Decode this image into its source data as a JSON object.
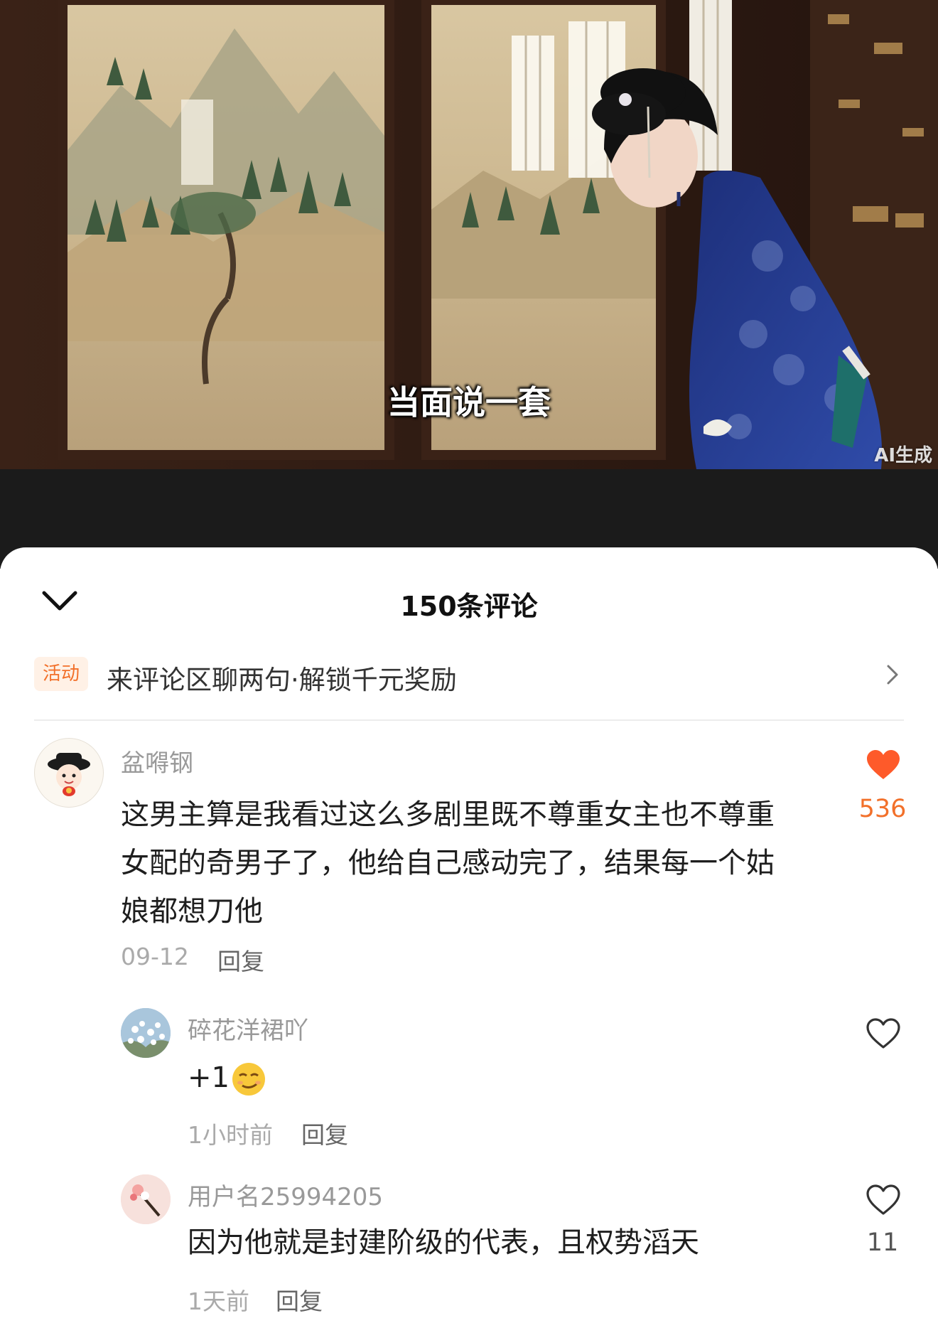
{
  "video": {
    "subtitle": "当面说一套",
    "ai_badge": "AI生成"
  },
  "comments_panel": {
    "title": "150条评论",
    "activity": {
      "tag": "活动",
      "text": "来评论区聊两句·解锁千元奖励"
    },
    "comments": [
      {
        "username": "盆嘚钢",
        "text_lines": [
          "这男主算是我看过这么多剧里既不尊重女主也不尊重",
          "女配的奇男子了，他给自己感动完了，结果每一个姑",
          "娘都想刀他"
        ],
        "time": "09-12",
        "reply_label": "回复",
        "likes": "536",
        "liked": true
      }
    ],
    "replies": [
      {
        "username": "碎花洋裙吖",
        "text": "+1",
        "emoji": "smirk-emoji",
        "time": "1小时前",
        "reply_label": "回复",
        "likes": "",
        "liked": false
      },
      {
        "username": "用户名25994205",
        "text": "因为他就是封建阶级的代表，且权势滔天",
        "time": "1天前",
        "reply_label": "回复",
        "likes": "11",
        "liked": false
      }
    ]
  },
  "colors": {
    "accent": "#f2702a",
    "like_active": "#fe5a2a",
    "text_primary": "#1e1e1e",
    "text_secondary": "#999999"
  }
}
